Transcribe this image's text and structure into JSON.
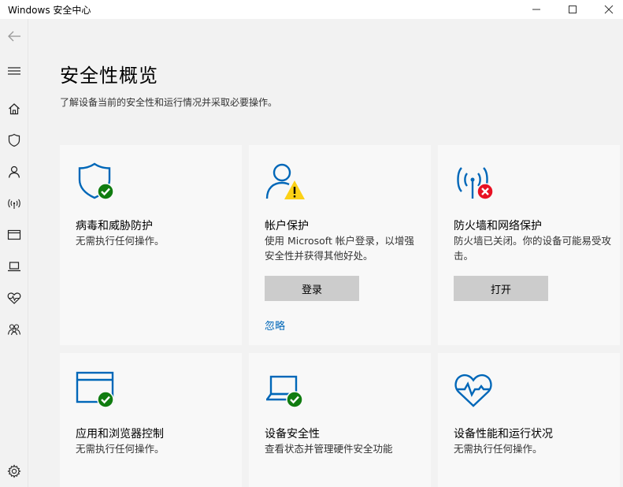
{
  "window": {
    "title": "Windows 安全中心"
  },
  "page": {
    "title": "安全性概览",
    "subtitle": "了解设备当前的安全性和运行情况并采取必要操作。"
  },
  "cards": [
    {
      "title": "病毒和威胁防护",
      "desc": "无需执行任何操作。",
      "icon": "shield-check-icon",
      "status": "ok"
    },
    {
      "title": "帐户保护",
      "desc": "使用 Microsoft 帐户登录，以增强安全性并获得其他好处。",
      "icon": "person-warning-icon",
      "status": "warning",
      "button": "登录",
      "link": "忽略"
    },
    {
      "title": "防火墙和网络保护",
      "desc": "防火墙已关闭。你的设备可能易受攻击。",
      "icon": "wifi-error-icon",
      "status": "error",
      "button": "打开"
    },
    {
      "title": "应用和浏览器控制",
      "desc": "无需执行任何操作。",
      "icon": "browser-check-icon",
      "status": "ok"
    },
    {
      "title": "设备安全性",
      "desc": "查看状态并管理硬件安全功能",
      "icon": "laptop-check-icon",
      "status": "ok"
    },
    {
      "title": "设备性能和运行状况",
      "desc": "无需执行任何操作。",
      "icon": "heart-pulse-icon",
      "status": "ok"
    }
  ],
  "colors": {
    "accent": "#0067b8",
    "ok": "#107c10",
    "warning": "#fcd116",
    "error": "#e81123"
  }
}
